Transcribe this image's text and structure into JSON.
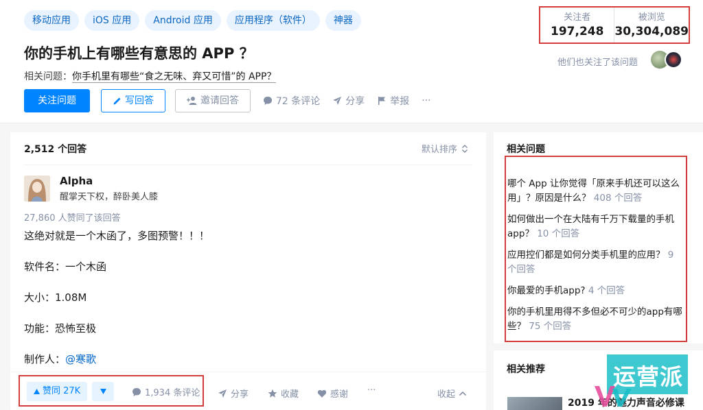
{
  "topics": [
    "移动应用",
    "iOS 应用",
    "Android 应用",
    "应用程序（软件）",
    "神器"
  ],
  "question": {
    "title": "你的手机上有哪些有意思的 APP ？",
    "related_prefix": "相关问题：",
    "related_link": "你手机里有哪些“食之无味、弃又可惜”的 APP？"
  },
  "actions": {
    "follow": "关注问题",
    "write": "写回答",
    "invite": "邀请回答",
    "comments": "72 条评论",
    "share": "分享",
    "report": "举报",
    "more": "···"
  },
  "stats": {
    "followers_label": "关注者",
    "followers_value": "197,248",
    "views_label": "被浏览",
    "views_value": "30,304,089",
    "also_follow": "他们也关注了该问题"
  },
  "answers": {
    "count": "2,512 个回答",
    "sort": "默认排序",
    "author_name": "Alpha",
    "author_bio": "醒掌天下权，醉卧美人膝",
    "vote_info": "27,860 人赞同了该回答",
    "lines": [
      "这绝对就是一个木函了，多图预警！！！",
      "软件名：一个木函",
      "大小：1.08M",
      "功能：恐怖至极"
    ],
    "maker_prefix": "制作人：",
    "maker_at": "@寒歌",
    "upvote": "赞同 27K",
    "comments": "1,934 条评论",
    "share": "分享",
    "collect": "收藏",
    "thanks": "感谢",
    "more": "···",
    "collapse": "收起"
  },
  "sidebar": {
    "related_title": "相关问题",
    "related": [
      {
        "text": "哪个 App 让你觉得「原来手机还可以这么用」？原因是什么？",
        "count": "408 个回答"
      },
      {
        "text": "如何做出一个在大陆有千万下载量的手机 app？",
        "count": "10 个回答"
      },
      {
        "text": "应用控们都是如何分类手机里的应用？",
        "count": "9 个回答"
      },
      {
        "text": "你最爱的手机app?",
        "count": "4 个回答"
      },
      {
        "text": "你的手机里用得不多但必不可少的app有哪些？",
        "count": "75 个回答"
      }
    ],
    "recommend_title": "相关推荐",
    "recommend_item": "2019 年的魅力声音必修课"
  },
  "watermark": "运营派",
  "colors": {
    "brand_blue": "#0084ff",
    "highlight_red": "#d43c3c",
    "watermark": "#1cbec8"
  }
}
